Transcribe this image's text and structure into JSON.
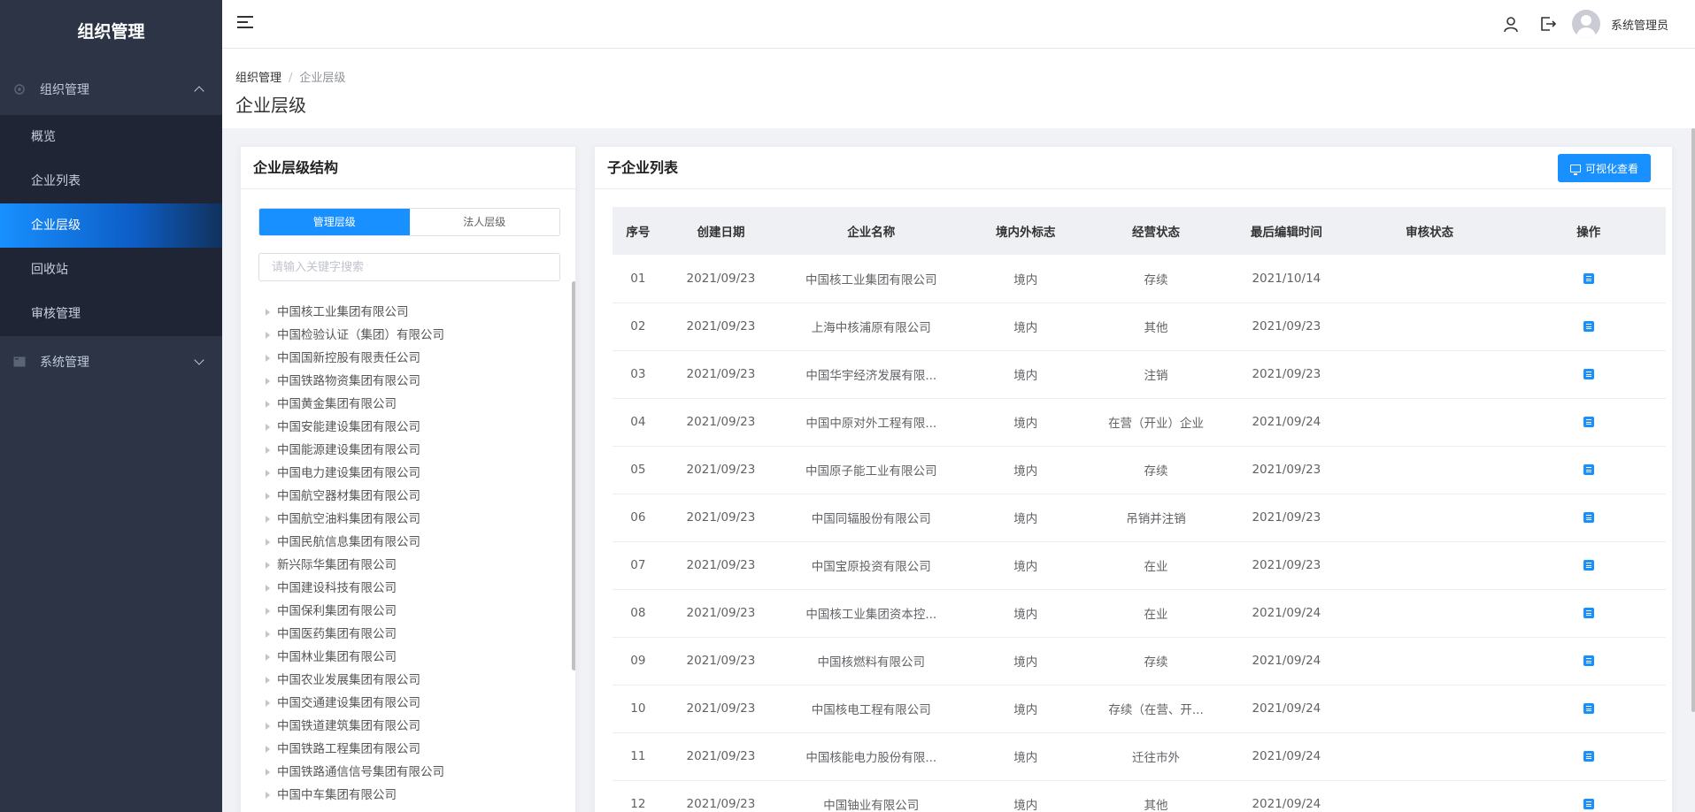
{
  "sidebar": {
    "logo": "组织管理",
    "groups": [
      {
        "label": "组织管理",
        "icon": "org-icon",
        "expanded": true
      },
      {
        "label": "系统管理",
        "icon": "system-icon",
        "expanded": false
      }
    ],
    "items": [
      {
        "label": "概览"
      },
      {
        "label": "企业列表"
      },
      {
        "label": "企业层级",
        "active": true
      },
      {
        "label": "回收站"
      },
      {
        "label": "审核管理"
      }
    ]
  },
  "header": {
    "username": "系统管理员",
    "icons": [
      "menu-fold-icon",
      "user-icon",
      "logout-icon",
      "avatar"
    ]
  },
  "breadcrumb": {
    "parent": "组织管理",
    "separator": "/",
    "current": "企业层级"
  },
  "page_title": "企业层级",
  "left_panel": {
    "title": "企业层级结构",
    "tabs": [
      {
        "label": "管理层级",
        "active": true
      },
      {
        "label": "法人层级",
        "active": false
      }
    ],
    "search_placeholder": "请输入关键字搜索",
    "tree": [
      "中国核工业集团有限公司",
      "中国检验认证（集团）有限公司",
      "中国国新控股有限责任公司",
      "中国铁路物资集团有限公司",
      "中国黄金集团有限公司",
      "中国安能建设集团有限公司",
      "中国能源建设集团有限公司",
      "中国电力建设集团有限公司",
      "中国航空器材集团有限公司",
      "中国航空油料集团有限公司",
      "中国民航信息集团有限公司",
      "新兴际华集团有限公司",
      "中国建设科技有限公司",
      "中国保利集团有限公司",
      "中国医药集团有限公司",
      "中国林业集团有限公司",
      "中国农业发展集团有限公司",
      "中国交通建设集团有限公司",
      "中国铁道建筑集团有限公司",
      "中国铁路工程集团有限公司",
      "中国铁路通信信号集团有限公司",
      "中国中车集团有限公司"
    ]
  },
  "right_panel": {
    "title": "子企业列表",
    "vis_button": "可视化查看",
    "columns": [
      "序号",
      "创建日期",
      "企业名称",
      "境内外标志",
      "经营状态",
      "最后编辑时间",
      "审核状态",
      "操作"
    ],
    "rows": [
      [
        "01",
        "2021/09/23",
        "中国核工业集团有限公司",
        "境内",
        "存续",
        "2021/10/14",
        ""
      ],
      [
        "02",
        "2021/09/23",
        "上海中核浦原有限公司",
        "境内",
        "其他",
        "2021/09/23",
        ""
      ],
      [
        "03",
        "2021/09/23",
        "中国华宇经济发展有限...",
        "境内",
        "注销",
        "2021/09/23",
        ""
      ],
      [
        "04",
        "2021/09/23",
        "中国中原对外工程有限...",
        "境内",
        "在营（开业）企业",
        "2021/09/24",
        ""
      ],
      [
        "05",
        "2021/09/23",
        "中国原子能工业有限公司",
        "境内",
        "存续",
        "2021/09/23",
        ""
      ],
      [
        "06",
        "2021/09/23",
        "中国同辐股份有限公司",
        "境内",
        "吊销并注销",
        "2021/09/23",
        ""
      ],
      [
        "07",
        "2021/09/23",
        "中国宝原投资有限公司",
        "境内",
        "在业",
        "2021/09/23",
        ""
      ],
      [
        "08",
        "2021/09/23",
        "中国核工业集团资本控...",
        "境内",
        "在业",
        "2021/09/24",
        ""
      ],
      [
        "09",
        "2021/09/23",
        "中国核燃料有限公司",
        "境内",
        "存续",
        "2021/09/24",
        ""
      ],
      [
        "10",
        "2021/09/23",
        "中国核电工程有限公司",
        "境内",
        "存续（在营、开...",
        "2021/09/24",
        ""
      ],
      [
        "11",
        "2021/09/23",
        "中国核能电力股份有限...",
        "境内",
        "迁往市外",
        "2021/09/24",
        ""
      ],
      [
        "12",
        "2021/09/23",
        "中国铀业有限公司",
        "境内",
        "其他",
        "2021/09/24",
        ""
      ]
    ],
    "op_icon": "edit-doc-icon"
  },
  "colors": {
    "sidebar_bg": "#2d3446",
    "accent": "#1890ff",
    "submenu_bg": "#1f2535"
  }
}
